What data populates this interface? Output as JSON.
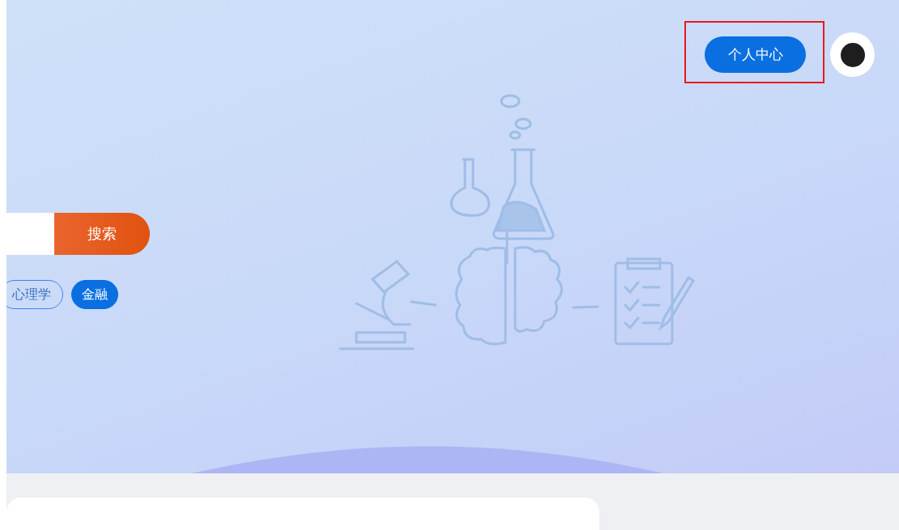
{
  "header": {
    "profile_button": "个人中心",
    "highlighted": true
  },
  "search": {
    "button": "搜索"
  },
  "tags": [
    {
      "label": "心理学",
      "selected": false
    },
    {
      "label": "金融",
      "selected": true
    }
  ]
}
